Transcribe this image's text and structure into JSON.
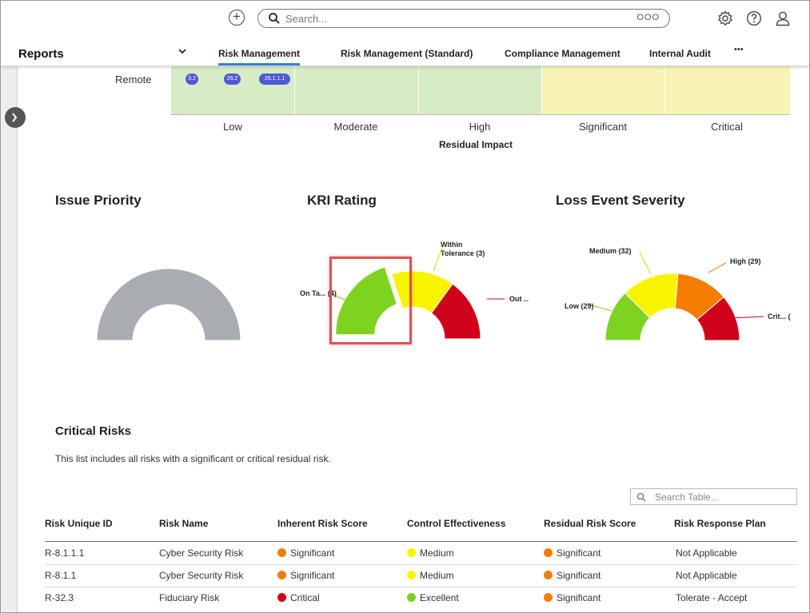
{
  "header": {
    "search_placeholder": "Search...",
    "more_label": "OOO"
  },
  "nav": {
    "title": "Reports",
    "tabs": [
      {
        "label": "Risk Management",
        "active": true
      },
      {
        "label": "Risk Management (Standard)",
        "active": false
      },
      {
        "label": "Compliance Management",
        "active": false
      },
      {
        "label": "Internal Audit",
        "active": false
      }
    ],
    "overflow_label": "•••"
  },
  "heatmap": {
    "row_label": "Remote",
    "badges": [
      "3.2",
      "26.2",
      "26.1.1.1"
    ],
    "impact_levels": [
      "Low",
      "Moderate",
      "High",
      "Significant",
      "Critical"
    ],
    "axis_title": "Residual Impact",
    "cell_colors": [
      "#d7ebc4",
      "#d7ebc4",
      "#d7ebc4",
      "#f8f3b5",
      "#f8f3b5"
    ]
  },
  "charts": {
    "issue_priority": {
      "title": "Issue Priority"
    },
    "kri_rating": {
      "title": "KRI Rating",
      "labels": {
        "on_target": "On Ta... (4)",
        "within_tol_1": "Within",
        "within_tol_2": "Tolerance (3)",
        "out": "Out ... (3"
      }
    },
    "loss_event_severity": {
      "title": "Loss Event Severity",
      "labels": {
        "low": "Low (29)",
        "medium": "Medium (32)",
        "high": "High (29)",
        "critical": "Crit... ("
      }
    }
  },
  "chart_data": [
    {
      "type": "pie",
      "title": "Issue Priority",
      "variant": "semi-donut",
      "slices": [
        {
          "label": "",
          "value": 1,
          "color": "#a9adb1"
        }
      ]
    },
    {
      "type": "pie",
      "title": "KRI Rating",
      "variant": "semi-donut",
      "slices": [
        {
          "label": "On Ta...",
          "value": 4,
          "color": "#7ed321"
        },
        {
          "label": "Within Tolerance",
          "value": 3,
          "color": "#f8f400"
        },
        {
          "label": "Out ...",
          "value": 3,
          "color": "#d0021b"
        }
      ]
    },
    {
      "type": "pie",
      "title": "Loss Event Severity",
      "variant": "semi-donut",
      "slices": [
        {
          "label": "Low",
          "value": 29,
          "color": "#7ed321"
        },
        {
          "label": "Medium",
          "value": 32,
          "color": "#f8f400"
        },
        {
          "label": "High",
          "value": 29,
          "color": "#f57c00"
        },
        {
          "label": "Crit...",
          "value": 26,
          "color": "#d0021b"
        }
      ]
    }
  ],
  "critical_risks": {
    "title": "Critical Risks",
    "description": "This list includes all risks with a significant or critical residual risk.",
    "search_placeholder": "Search Table...",
    "columns": [
      "Risk Unique ID",
      "Risk Name",
      "Inherent Risk Score",
      "Control Effectiveness",
      "Residual Risk Score",
      "Risk Response Plan"
    ],
    "rows": [
      {
        "id": "R-8.1.1.1",
        "name": "Cyber Security Risk",
        "inherent": "Significant",
        "inherent_color": "#f57c00",
        "control": "Medium",
        "control_color": "#f8f400",
        "residual": "Significant",
        "residual_color": "#f57c00",
        "plan": "Not Applicable"
      },
      {
        "id": "R-8.1.1",
        "name": "Cyber Security Risk",
        "inherent": "Significant",
        "inherent_color": "#f57c00",
        "control": "Medium",
        "control_color": "#f8f400",
        "residual": "Significant",
        "residual_color": "#f57c00",
        "plan": "Not Applicable"
      },
      {
        "id": "R-32.3",
        "name": "Fiduciary Risk",
        "inherent": "Critical",
        "inherent_color": "#d0021b",
        "control": "Excellent",
        "control_color": "#7ed321",
        "residual": "Significant",
        "residual_color": "#f57c00",
        "plan": "Tolerate - Accept"
      }
    ]
  }
}
